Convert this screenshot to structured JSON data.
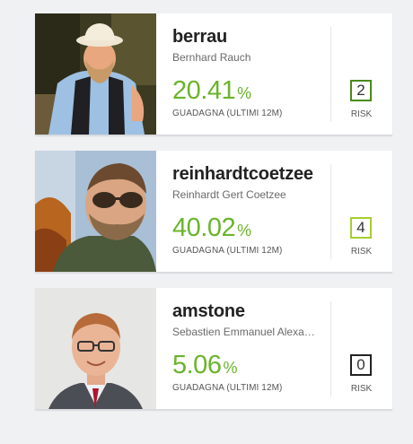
{
  "traders": [
    {
      "username": "berrau",
      "full_name": "Bernhard Rauch",
      "gain_value": "20.41",
      "gain_unit": "%",
      "gain_label": "GUADAGNA (ULTIMI 12M)",
      "risk_score": "2",
      "risk_label": "RISK",
      "risk_color": "#4a8a1c"
    },
    {
      "username": "reinhardtcoetzee",
      "full_name": "Reinhardt Gert Coetzee",
      "gain_value": "40.02",
      "gain_unit": "%",
      "gain_label": "GUADAGNA (ULTIMI 12M)",
      "risk_score": "4",
      "risk_label": "RISK",
      "risk_color": "#a6cf2e"
    },
    {
      "username": "amstone",
      "full_name": "Sebastien Emmanuel Alexa…",
      "gain_value": "5.06",
      "gain_unit": "%",
      "gain_label": "GUADAGNA (ULTIMI 12M)",
      "risk_score": "0",
      "risk_label": "RISK",
      "risk_color": "#222222"
    }
  ],
  "colors": {
    "gain_green": "#6ab42b",
    "page_bg": "#f0f1f3"
  }
}
